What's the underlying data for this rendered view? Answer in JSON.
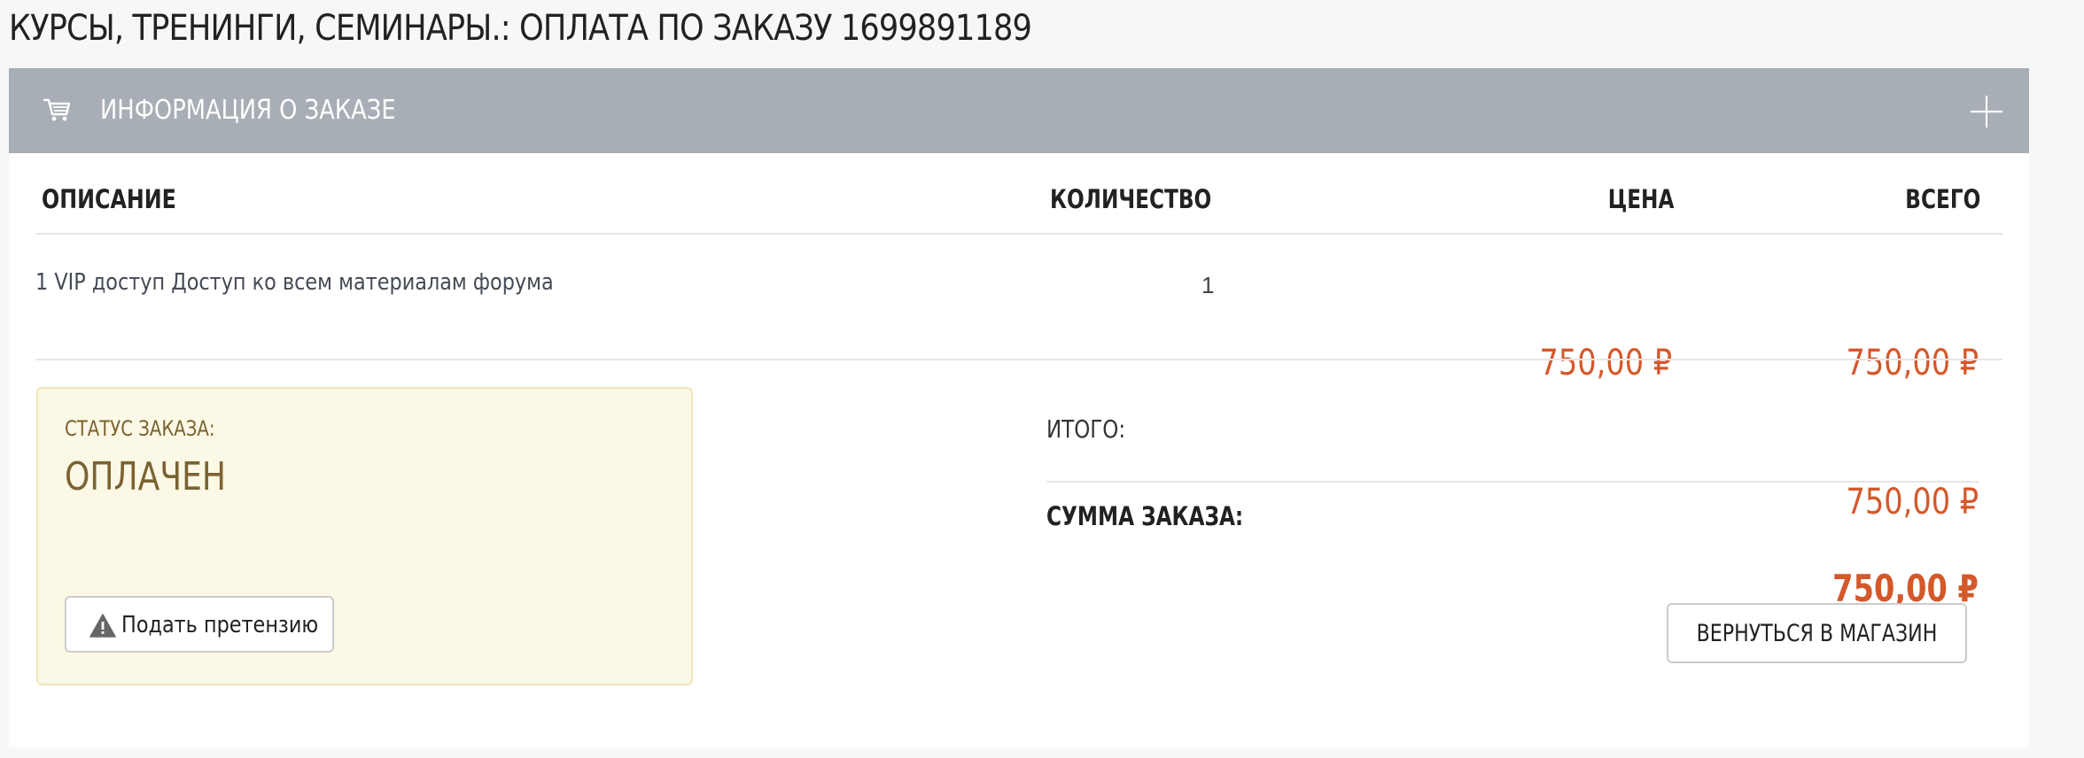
{
  "page": {
    "title": "КУРСЫ, ТРЕНИНГИ, СЕМИНАРЫ.: ОПЛАТА ПО ЗАКАЗУ 1699891189"
  },
  "panel": {
    "header_title": "ИНФОРМАЦИЯ О ЗАКАЗЕ",
    "header_icon": "cart-icon",
    "expand_icon": "plus-icon"
  },
  "table": {
    "columns": {
      "description": "ОПИСАНИЕ",
      "quantity": "КОЛИЧЕСТВО",
      "price": "ЦЕНА",
      "total": "ВСЕГО"
    },
    "rows": [
      {
        "description": "1 VIP доступ Доступ ко всем материалам форума",
        "quantity": "1",
        "price": "750,00 ₽",
        "total": "750,00 ₽"
      }
    ]
  },
  "status": {
    "label": "СТАТУС ЗАКАЗА:",
    "value": "ОПЛАЧЕН",
    "claim_button": "Подать претензию",
    "claim_icon": "warning-icon"
  },
  "summary": {
    "subtotal_label": "ИТОГО:",
    "subtotal_value": "750,00 ₽",
    "order_sum_label": "СУММА ЗАКАЗА:",
    "order_sum_value": "750,00 ₽"
  },
  "actions": {
    "back_to_shop": "ВЕРНУТЬСЯ В МАГАЗИН"
  },
  "colors": {
    "header_bg": "#a8aeb5",
    "price": "#d4582a",
    "status_bg": "#fbf8e5",
    "status_text": "#7a6232"
  }
}
